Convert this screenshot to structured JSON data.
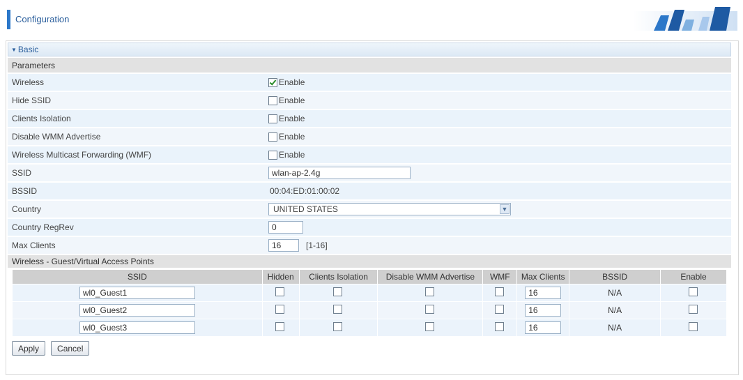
{
  "header": {
    "title": "Configuration"
  },
  "section": {
    "title": "Basic"
  },
  "parameters_heading": "Parameters",
  "fields": [
    {
      "label": "Wireless",
      "checked": true,
      "option": "Enable"
    },
    {
      "label": "Hide SSID",
      "checked": false,
      "option": "Enable"
    },
    {
      "label": "Clients Isolation",
      "checked": false,
      "option": "Enable"
    },
    {
      "label": "Disable WMM Advertise",
      "checked": false,
      "option": "Enable"
    },
    {
      "label": "Wireless Multicast Forwarding (WMF)",
      "checked": false,
      "option": "Enable"
    }
  ],
  "ssid": {
    "label": "SSID",
    "value": "wlan-ap-2.4g"
  },
  "bssid": {
    "label": "BSSID",
    "value": "00:04:ED:01:00:02"
  },
  "country": {
    "label": "Country",
    "value": "UNITED STATES"
  },
  "regrev": {
    "label": "Country RegRev",
    "value": "0"
  },
  "max_clients": {
    "label": "Max Clients",
    "value": "16",
    "range": "[1-16]"
  },
  "guest": {
    "heading": "Wireless - Guest/Virtual Access Points",
    "columns": [
      "SSID",
      "Hidden",
      "Clients Isolation",
      "Disable WMM Advertise",
      "WMF",
      "Max Clients",
      "BSSID",
      "Enable"
    ],
    "rows": [
      {
        "ssid": "wl0_Guest1",
        "max_clients": "16",
        "bssid": "N/A"
      },
      {
        "ssid": "wl0_Guest2",
        "max_clients": "16",
        "bssid": "N/A"
      },
      {
        "ssid": "wl0_Guest3",
        "max_clients": "16",
        "bssid": "N/A"
      }
    ]
  },
  "buttons": {
    "apply": "Apply",
    "cancel": "Cancel"
  },
  "colors": {
    "accent": "#2b77c9",
    "title": "#2a5e9c",
    "row_bg": "#eaf3fb",
    "header_bg": "#e2e2e2"
  }
}
